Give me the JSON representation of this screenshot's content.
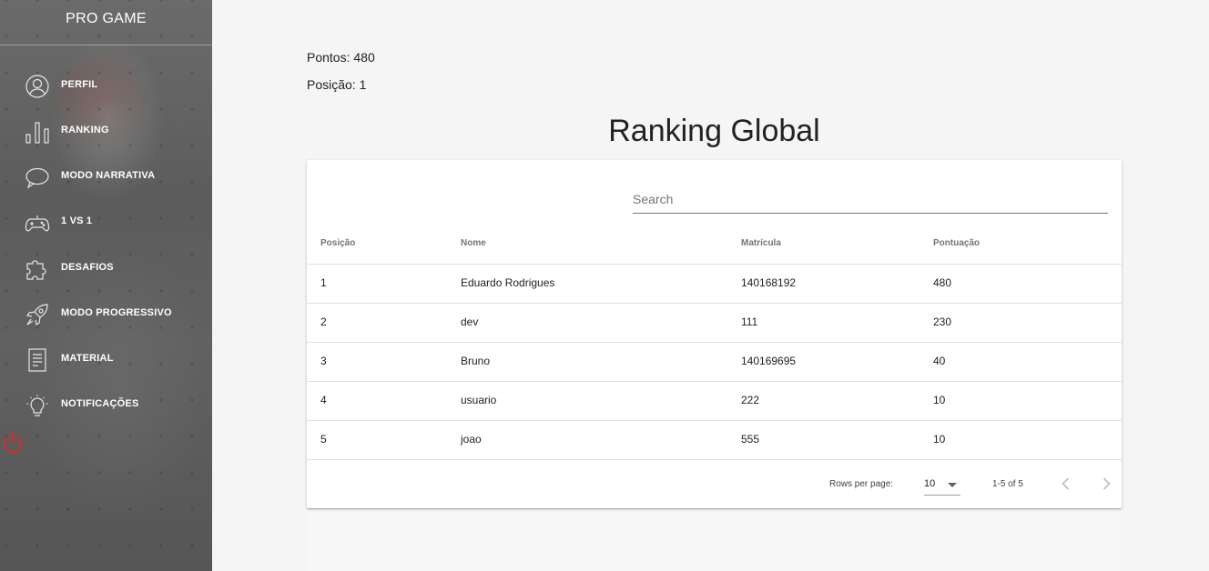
{
  "app": {
    "title": "PRO GAME"
  },
  "sidebar": {
    "items": [
      {
        "label": "PERFIL",
        "icon": "user-circle-icon"
      },
      {
        "label": "RANKING",
        "icon": "bar-chart-icon"
      },
      {
        "label": "MODO NARRATIVA",
        "icon": "speech-bubble-icon"
      },
      {
        "label": "1 VS 1",
        "icon": "gamepad-icon"
      },
      {
        "label": "DESAFIOS",
        "icon": "puzzle-icon"
      },
      {
        "label": "MODO PROGRESSIVO",
        "icon": "rocket-icon"
      },
      {
        "label": "MATERIAL",
        "icon": "document-icon"
      },
      {
        "label": "NOTIFICAÇÕES",
        "icon": "lightbulb-icon"
      }
    ],
    "logout_icon": "power-icon",
    "logout_color": "#d32f2f"
  },
  "stats": {
    "points": "Pontos: 480",
    "position": "Posição: 1"
  },
  "ranking": {
    "title": "Ranking Global",
    "search_placeholder": "Search",
    "columns": [
      "Posição",
      "Nome",
      "Matrícula",
      "Pontuação"
    ],
    "rows": [
      [
        "1",
        "Eduardo Rodrigues",
        "140168192",
        "480"
      ],
      [
        "2",
        "dev",
        "111",
        "230"
      ],
      [
        "3",
        "Bruno",
        "140169695",
        "40"
      ],
      [
        "4",
        "usuario",
        "222",
        "10"
      ],
      [
        "5",
        "joao",
        "555",
        "10"
      ]
    ],
    "pagination": {
      "rows_per_page_label": "Rows per page:",
      "rows_per_page": "10",
      "range": "1-5 of 5"
    }
  }
}
